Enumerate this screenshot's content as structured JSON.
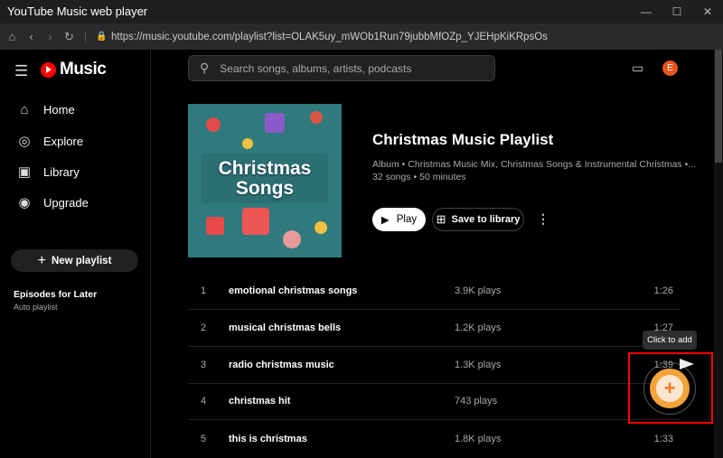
{
  "window": {
    "title": "YouTube Music web player",
    "url": "https://music.youtube.com/playlist?list=OLAK5uy_mWOb1Run79jubbMfOZp_YJEHpKiKRpsOs"
  },
  "sidebar": {
    "logo": "Music",
    "items": [
      {
        "label": "Home",
        "icon": "home-icon"
      },
      {
        "label": "Explore",
        "icon": "compass-icon"
      },
      {
        "label": "Library",
        "icon": "library-icon"
      },
      {
        "label": "Upgrade",
        "icon": "youtube-icon"
      }
    ],
    "new_playlist": "New playlist",
    "episodes_title": "Episodes for Later",
    "episodes_sub": "Auto playlist"
  },
  "header": {
    "search_placeholder": "Search songs, albums, artists, podcasts",
    "avatar": "E"
  },
  "playlist": {
    "art_text": "Christmas Songs",
    "title": "Christmas Music Playlist",
    "meta1": "Album • Christmas Music Mix, Christmas Songs & Instrumental Christmas •...",
    "meta2": "32 songs • 50 minutes",
    "play": "Play",
    "save": "Save to library"
  },
  "tracks": [
    {
      "n": "1",
      "title": "emotional christmas songs",
      "plays": "3.9K plays",
      "dur": "1:26"
    },
    {
      "n": "2",
      "title": "musical christmas bells",
      "plays": "1.2K plays",
      "dur": "1:27"
    },
    {
      "n": "3",
      "title": "radio christmas music",
      "plays": "1.3K plays",
      "dur": "1:39"
    },
    {
      "n": "4",
      "title": "christmas hit",
      "plays": "743 plays",
      "dur": ""
    },
    {
      "n": "5",
      "title": "this is christmas",
      "plays": "1.8K plays",
      "dur": "1:33"
    }
  ],
  "overlay": {
    "tooltip": "Click to add",
    "accent": "#f2a33a",
    "highlight": "#ff0000"
  }
}
